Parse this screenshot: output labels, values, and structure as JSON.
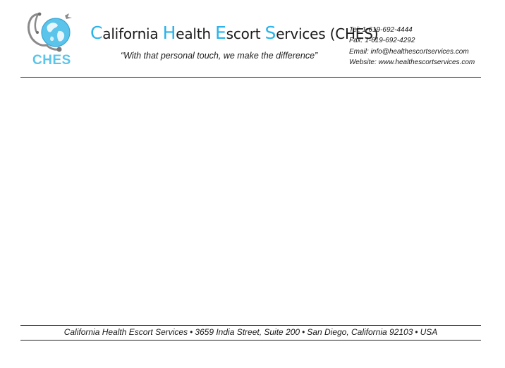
{
  "logo": {
    "text": "CHES",
    "icon": "globe-stethoscope-icon",
    "color": "#5bc4ea"
  },
  "header": {
    "company_name_parts": [
      {
        "cap": "C",
        "rest": "alifornia "
      },
      {
        "cap": "H",
        "rest": "ealth "
      },
      {
        "cap": "E",
        "rest": "scort "
      },
      {
        "cap": "S",
        "rest": "ervices (CHES)"
      }
    ],
    "tagline": "“With that personal touch, we make the difference”",
    "accent_color": "#29b3ea"
  },
  "contact": {
    "tel": "Tel: 1-619-692-4444",
    "fax": "Fax: 1-619-692-4292",
    "email": "Email: info@healthescortservices.com",
    "website": "Website: www.healthescortservices.com"
  },
  "footer": {
    "parts": [
      "California Health Escort Services",
      "3659 India Street, Suite 200",
      "San Diego, California  92103",
      "USA"
    ],
    "separator": "•"
  }
}
